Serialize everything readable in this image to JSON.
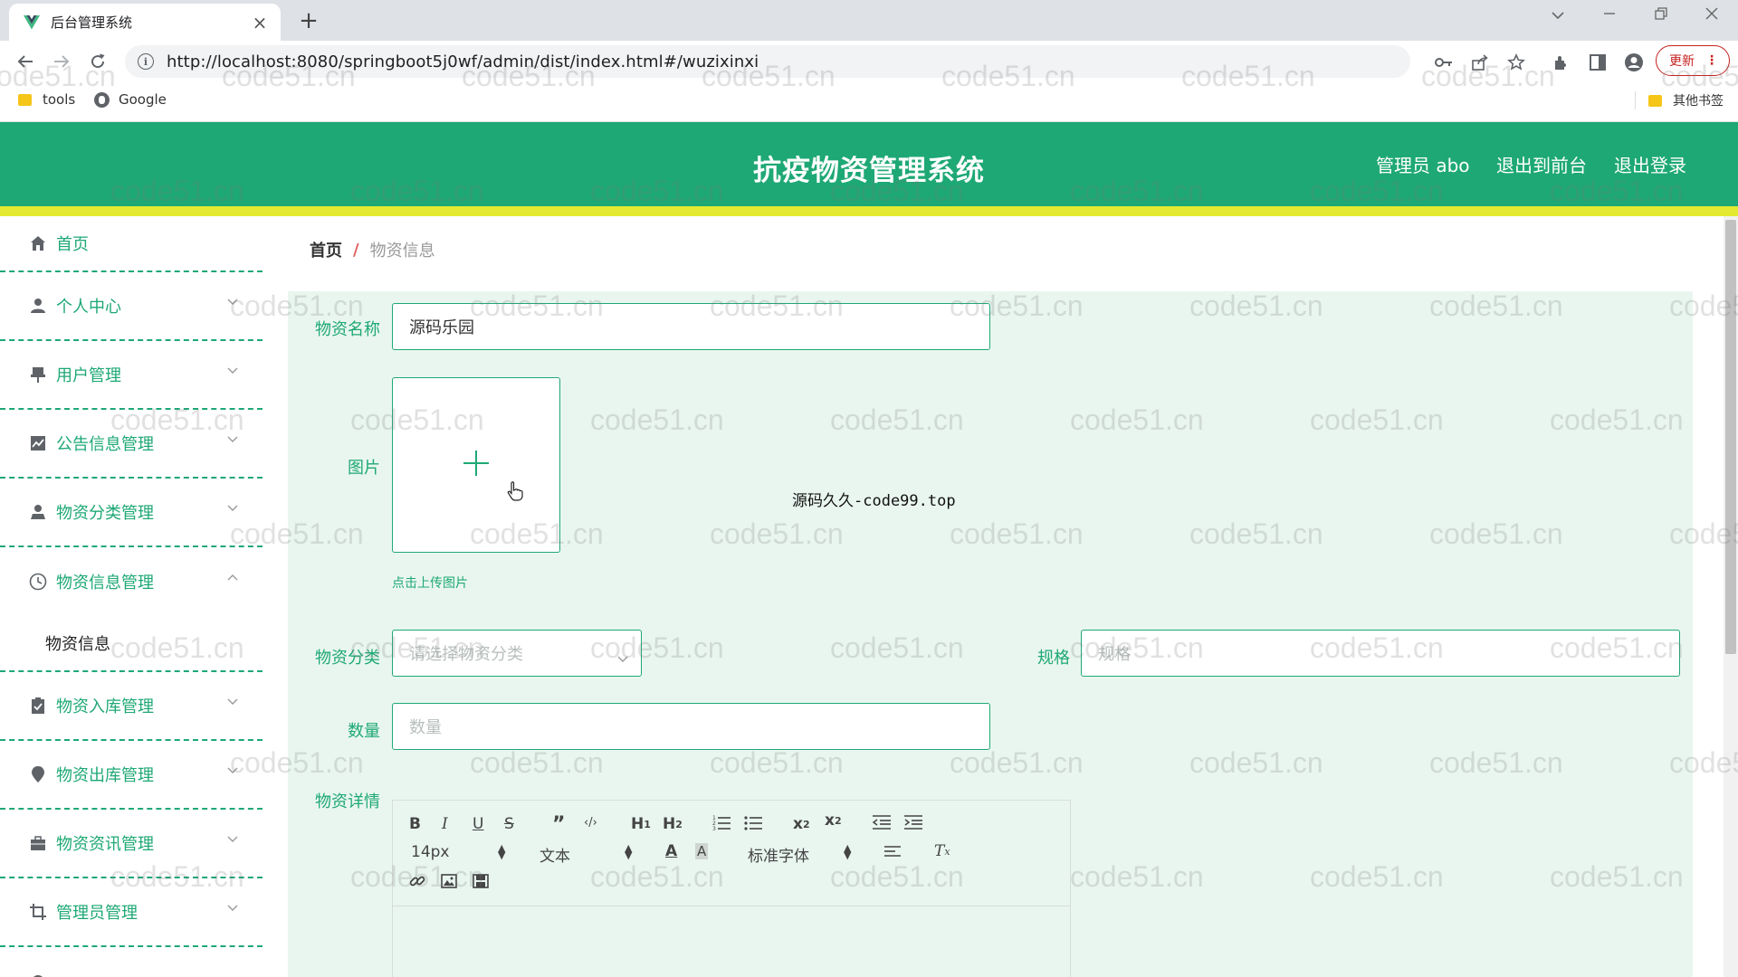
{
  "browser": {
    "tab_title": "后台管理系统",
    "url": "http://localhost:8080/springboot5j0wf/admin/dist/index.html#/wuzixinxi",
    "update_label": "更新",
    "bookmarks": [
      "tools",
      "Google"
    ],
    "other_bookmarks": "其他书签"
  },
  "header": {
    "title": "抗疫物资管理系统",
    "user": "管理员 abo",
    "to_front": "退出到前台",
    "logout": "退出登录",
    "brand_color": "#1ea875",
    "accent_color": "#e3ea31"
  },
  "sidebar": {
    "items": [
      {
        "label": "首页",
        "icon": "home-icon"
      },
      {
        "label": "个人中心",
        "icon": "user-icon"
      },
      {
        "label": "用户管理",
        "icon": "pushpin-icon"
      },
      {
        "label": "公告信息管理",
        "icon": "chart-icon"
      },
      {
        "label": "物资分类管理",
        "icon": "person-icon"
      },
      {
        "label": "物资信息管理",
        "icon": "clock-icon"
      },
      {
        "label": "物资入库管理",
        "icon": "clipboard-icon"
      },
      {
        "label": "物资出库管理",
        "icon": "pin-icon"
      },
      {
        "label": "物资资讯管理",
        "icon": "briefcase-icon"
      },
      {
        "label": "管理员管理",
        "icon": "crop-icon"
      }
    ],
    "sub_items": [
      "物资信息"
    ]
  },
  "breadcrumb": {
    "home": "首页",
    "separator": "/",
    "current": "物资信息"
  },
  "form": {
    "name_label": "物资名称",
    "name_value": "源码乐园",
    "image_label": "图片",
    "upload_hint": "点击上传图片",
    "category_label": "物资分类",
    "category_placeholder": "请选择物资分类",
    "spec_label": "规格",
    "spec_placeholder": "规格",
    "qty_label": "数量",
    "qty_placeholder": "数量",
    "detail_label": "物资详情"
  },
  "editor": {
    "font_size": "14px",
    "block_format": "文本",
    "font_family": "标准字体"
  },
  "overlay_text": "源码久久-code99.top",
  "watermark": "code51.cn"
}
